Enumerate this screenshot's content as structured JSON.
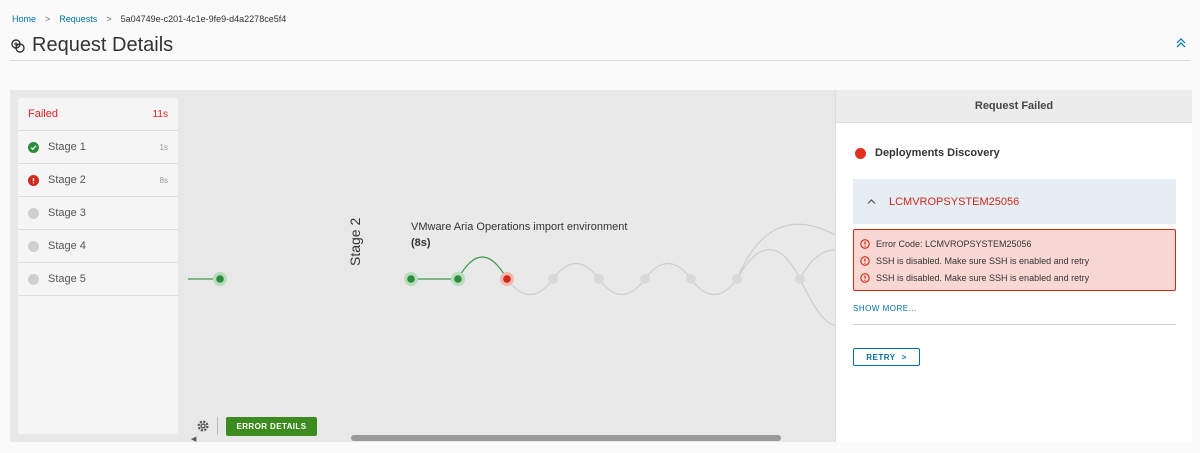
{
  "breadcrumb": {
    "items": [
      "Home",
      "Requests",
      "5a04749e-c201-4c1e-9fe9-d4a2278ce5f4"
    ]
  },
  "page": {
    "title": "Request Details"
  },
  "stages": {
    "header": {
      "label": "Failed",
      "duration": "11s"
    },
    "items": [
      {
        "label": "Stage 1",
        "duration": "1s",
        "status": "success"
      },
      {
        "label": "Stage 2",
        "duration": "8s",
        "status": "error"
      },
      {
        "label": "Stage 3",
        "duration": "",
        "status": "pending"
      },
      {
        "label": "Stage 4",
        "duration": "",
        "status": "pending"
      },
      {
        "label": "Stage 5",
        "duration": "",
        "status": "pending"
      }
    ]
  },
  "graph": {
    "stage_label": "Stage 2",
    "step_title": "VMware Aria Operations import environment",
    "step_duration": "(8s)",
    "colors": {
      "success": "#2e8b3d",
      "error": "#d0281b",
      "pending": "#cfcfcf"
    }
  },
  "toolbar": {
    "error_details_label": "ERROR DETAILS"
  },
  "right_panel": {
    "title": "Request Failed",
    "task_name": "Deployments Discovery",
    "error_code_header": "LCMVROPSYSTEM25056",
    "errors": [
      "Error Code: LCMVROPSYSTEM25056",
      "SSH is disabled. Make sure SSH is enabled and retry",
      "SSH is disabled. Make sure SSH is enabled and retry"
    ],
    "show_more_label": "SHOW MORE...",
    "retry_label": "RETRY"
  }
}
